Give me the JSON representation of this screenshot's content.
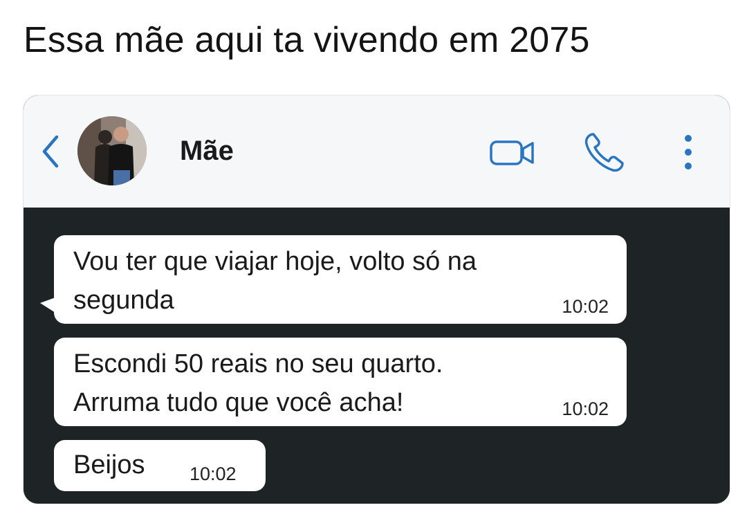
{
  "caption": "Essa mãe aqui ta vivendo em 2075",
  "header": {
    "contact_name": "Mãe",
    "icons": {
      "back": "chevron-left-icon",
      "avatar": "contact-avatar",
      "video": "video-camera-icon",
      "call": "phone-icon",
      "more": "more-vertical-icon"
    },
    "accent_color": "#2a74c4"
  },
  "messages": [
    {
      "lines": [
        "Vou ter que viajar hoje, volto só na",
        "segunda"
      ],
      "time": "10:02"
    },
    {
      "lines": [
        "Escondi 50 reais no seu quarto.",
        "Arruma tudo que você acha!"
      ],
      "time": "10:02"
    },
    {
      "lines": [
        "Beijos"
      ],
      "time": "10:02"
    }
  ]
}
